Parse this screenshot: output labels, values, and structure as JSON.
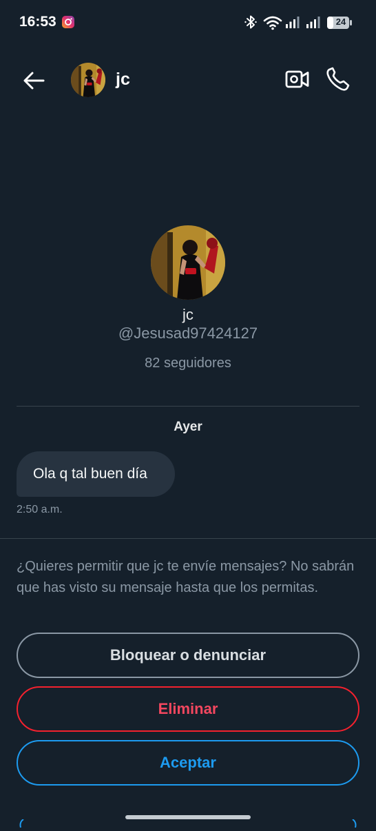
{
  "status_bar": {
    "time": "16:53",
    "battery": "24",
    "icons": [
      "instagram-notification-icon",
      "bluetooth-icon",
      "wifi-icon",
      "signal-icon",
      "signal-icon",
      "battery-icon"
    ]
  },
  "header": {
    "name": "jc",
    "icons": [
      "back-arrow-icon",
      "video-call-icon",
      "phone-icon"
    ]
  },
  "profile": {
    "name": "jc",
    "handle": "@Jesusad97424127",
    "followers": "82 seguidores"
  },
  "conversation": {
    "day_label": "Ayer",
    "messages": [
      {
        "text": "Ola q tal buen día",
        "time": "2:50 a.m."
      }
    ]
  },
  "request": {
    "prompt": "¿Quieres permitir que jc te envíe mensajes? No sabrán que has visto su mensaje hasta que los permitas.",
    "block_label": "Bloquear o denunciar",
    "delete_label": "Eliminar",
    "accept_label": "Aceptar"
  },
  "colors": {
    "background": "#15202b",
    "accent": "#1d9bf0",
    "danger": "#f4212e",
    "bubble": "#273340",
    "secondary_text": "#8b98a5"
  }
}
